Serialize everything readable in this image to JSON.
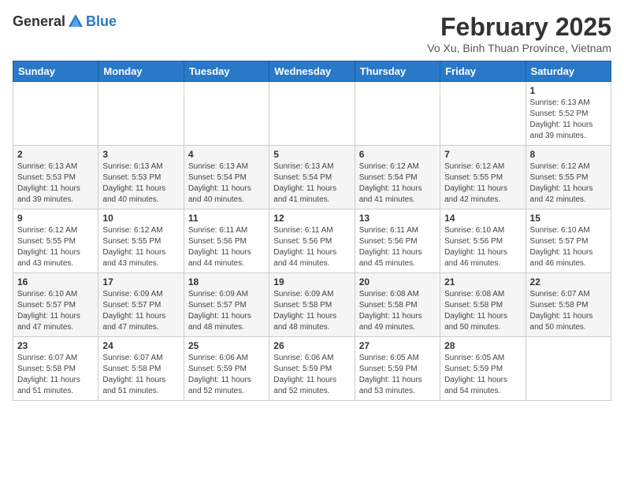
{
  "logo": {
    "general": "General",
    "blue": "Blue"
  },
  "title": {
    "month_year": "February 2025",
    "location": "Vo Xu, Binh Thuan Province, Vietnam"
  },
  "days_of_week": [
    "Sunday",
    "Monday",
    "Tuesday",
    "Wednesday",
    "Thursday",
    "Friday",
    "Saturday"
  ],
  "weeks": [
    [
      {
        "day": "",
        "info": ""
      },
      {
        "day": "",
        "info": ""
      },
      {
        "day": "",
        "info": ""
      },
      {
        "day": "",
        "info": ""
      },
      {
        "day": "",
        "info": ""
      },
      {
        "day": "",
        "info": ""
      },
      {
        "day": "1",
        "info": "Sunrise: 6:13 AM\nSunset: 5:52 PM\nDaylight: 11 hours and 39 minutes."
      }
    ],
    [
      {
        "day": "2",
        "info": "Sunrise: 6:13 AM\nSunset: 5:53 PM\nDaylight: 11 hours and 39 minutes."
      },
      {
        "day": "3",
        "info": "Sunrise: 6:13 AM\nSunset: 5:53 PM\nDaylight: 11 hours and 40 minutes."
      },
      {
        "day": "4",
        "info": "Sunrise: 6:13 AM\nSunset: 5:54 PM\nDaylight: 11 hours and 40 minutes."
      },
      {
        "day": "5",
        "info": "Sunrise: 6:13 AM\nSunset: 5:54 PM\nDaylight: 11 hours and 41 minutes."
      },
      {
        "day": "6",
        "info": "Sunrise: 6:12 AM\nSunset: 5:54 PM\nDaylight: 11 hours and 41 minutes."
      },
      {
        "day": "7",
        "info": "Sunrise: 6:12 AM\nSunset: 5:55 PM\nDaylight: 11 hours and 42 minutes."
      },
      {
        "day": "8",
        "info": "Sunrise: 6:12 AM\nSunset: 5:55 PM\nDaylight: 11 hours and 42 minutes."
      }
    ],
    [
      {
        "day": "9",
        "info": "Sunrise: 6:12 AM\nSunset: 5:55 PM\nDaylight: 11 hours and 43 minutes."
      },
      {
        "day": "10",
        "info": "Sunrise: 6:12 AM\nSunset: 5:55 PM\nDaylight: 11 hours and 43 minutes."
      },
      {
        "day": "11",
        "info": "Sunrise: 6:11 AM\nSunset: 5:56 PM\nDaylight: 11 hours and 44 minutes."
      },
      {
        "day": "12",
        "info": "Sunrise: 6:11 AM\nSunset: 5:56 PM\nDaylight: 11 hours and 44 minutes."
      },
      {
        "day": "13",
        "info": "Sunrise: 6:11 AM\nSunset: 5:56 PM\nDaylight: 11 hours and 45 minutes."
      },
      {
        "day": "14",
        "info": "Sunrise: 6:10 AM\nSunset: 5:56 PM\nDaylight: 11 hours and 46 minutes."
      },
      {
        "day": "15",
        "info": "Sunrise: 6:10 AM\nSunset: 5:57 PM\nDaylight: 11 hours and 46 minutes."
      }
    ],
    [
      {
        "day": "16",
        "info": "Sunrise: 6:10 AM\nSunset: 5:57 PM\nDaylight: 11 hours and 47 minutes."
      },
      {
        "day": "17",
        "info": "Sunrise: 6:09 AM\nSunset: 5:57 PM\nDaylight: 11 hours and 47 minutes."
      },
      {
        "day": "18",
        "info": "Sunrise: 6:09 AM\nSunset: 5:57 PM\nDaylight: 11 hours and 48 minutes."
      },
      {
        "day": "19",
        "info": "Sunrise: 6:09 AM\nSunset: 5:58 PM\nDaylight: 11 hours and 48 minutes."
      },
      {
        "day": "20",
        "info": "Sunrise: 6:08 AM\nSunset: 5:58 PM\nDaylight: 11 hours and 49 minutes."
      },
      {
        "day": "21",
        "info": "Sunrise: 6:08 AM\nSunset: 5:58 PM\nDaylight: 11 hours and 50 minutes."
      },
      {
        "day": "22",
        "info": "Sunrise: 6:07 AM\nSunset: 5:58 PM\nDaylight: 11 hours and 50 minutes."
      }
    ],
    [
      {
        "day": "23",
        "info": "Sunrise: 6:07 AM\nSunset: 5:58 PM\nDaylight: 11 hours and 51 minutes."
      },
      {
        "day": "24",
        "info": "Sunrise: 6:07 AM\nSunset: 5:58 PM\nDaylight: 11 hours and 51 minutes."
      },
      {
        "day": "25",
        "info": "Sunrise: 6:06 AM\nSunset: 5:59 PM\nDaylight: 11 hours and 52 minutes."
      },
      {
        "day": "26",
        "info": "Sunrise: 6:06 AM\nSunset: 5:59 PM\nDaylight: 11 hours and 52 minutes."
      },
      {
        "day": "27",
        "info": "Sunrise: 6:05 AM\nSunset: 5:59 PM\nDaylight: 11 hours and 53 minutes."
      },
      {
        "day": "28",
        "info": "Sunrise: 6:05 AM\nSunset: 5:59 PM\nDaylight: 11 hours and 54 minutes."
      },
      {
        "day": "",
        "info": ""
      }
    ]
  ]
}
